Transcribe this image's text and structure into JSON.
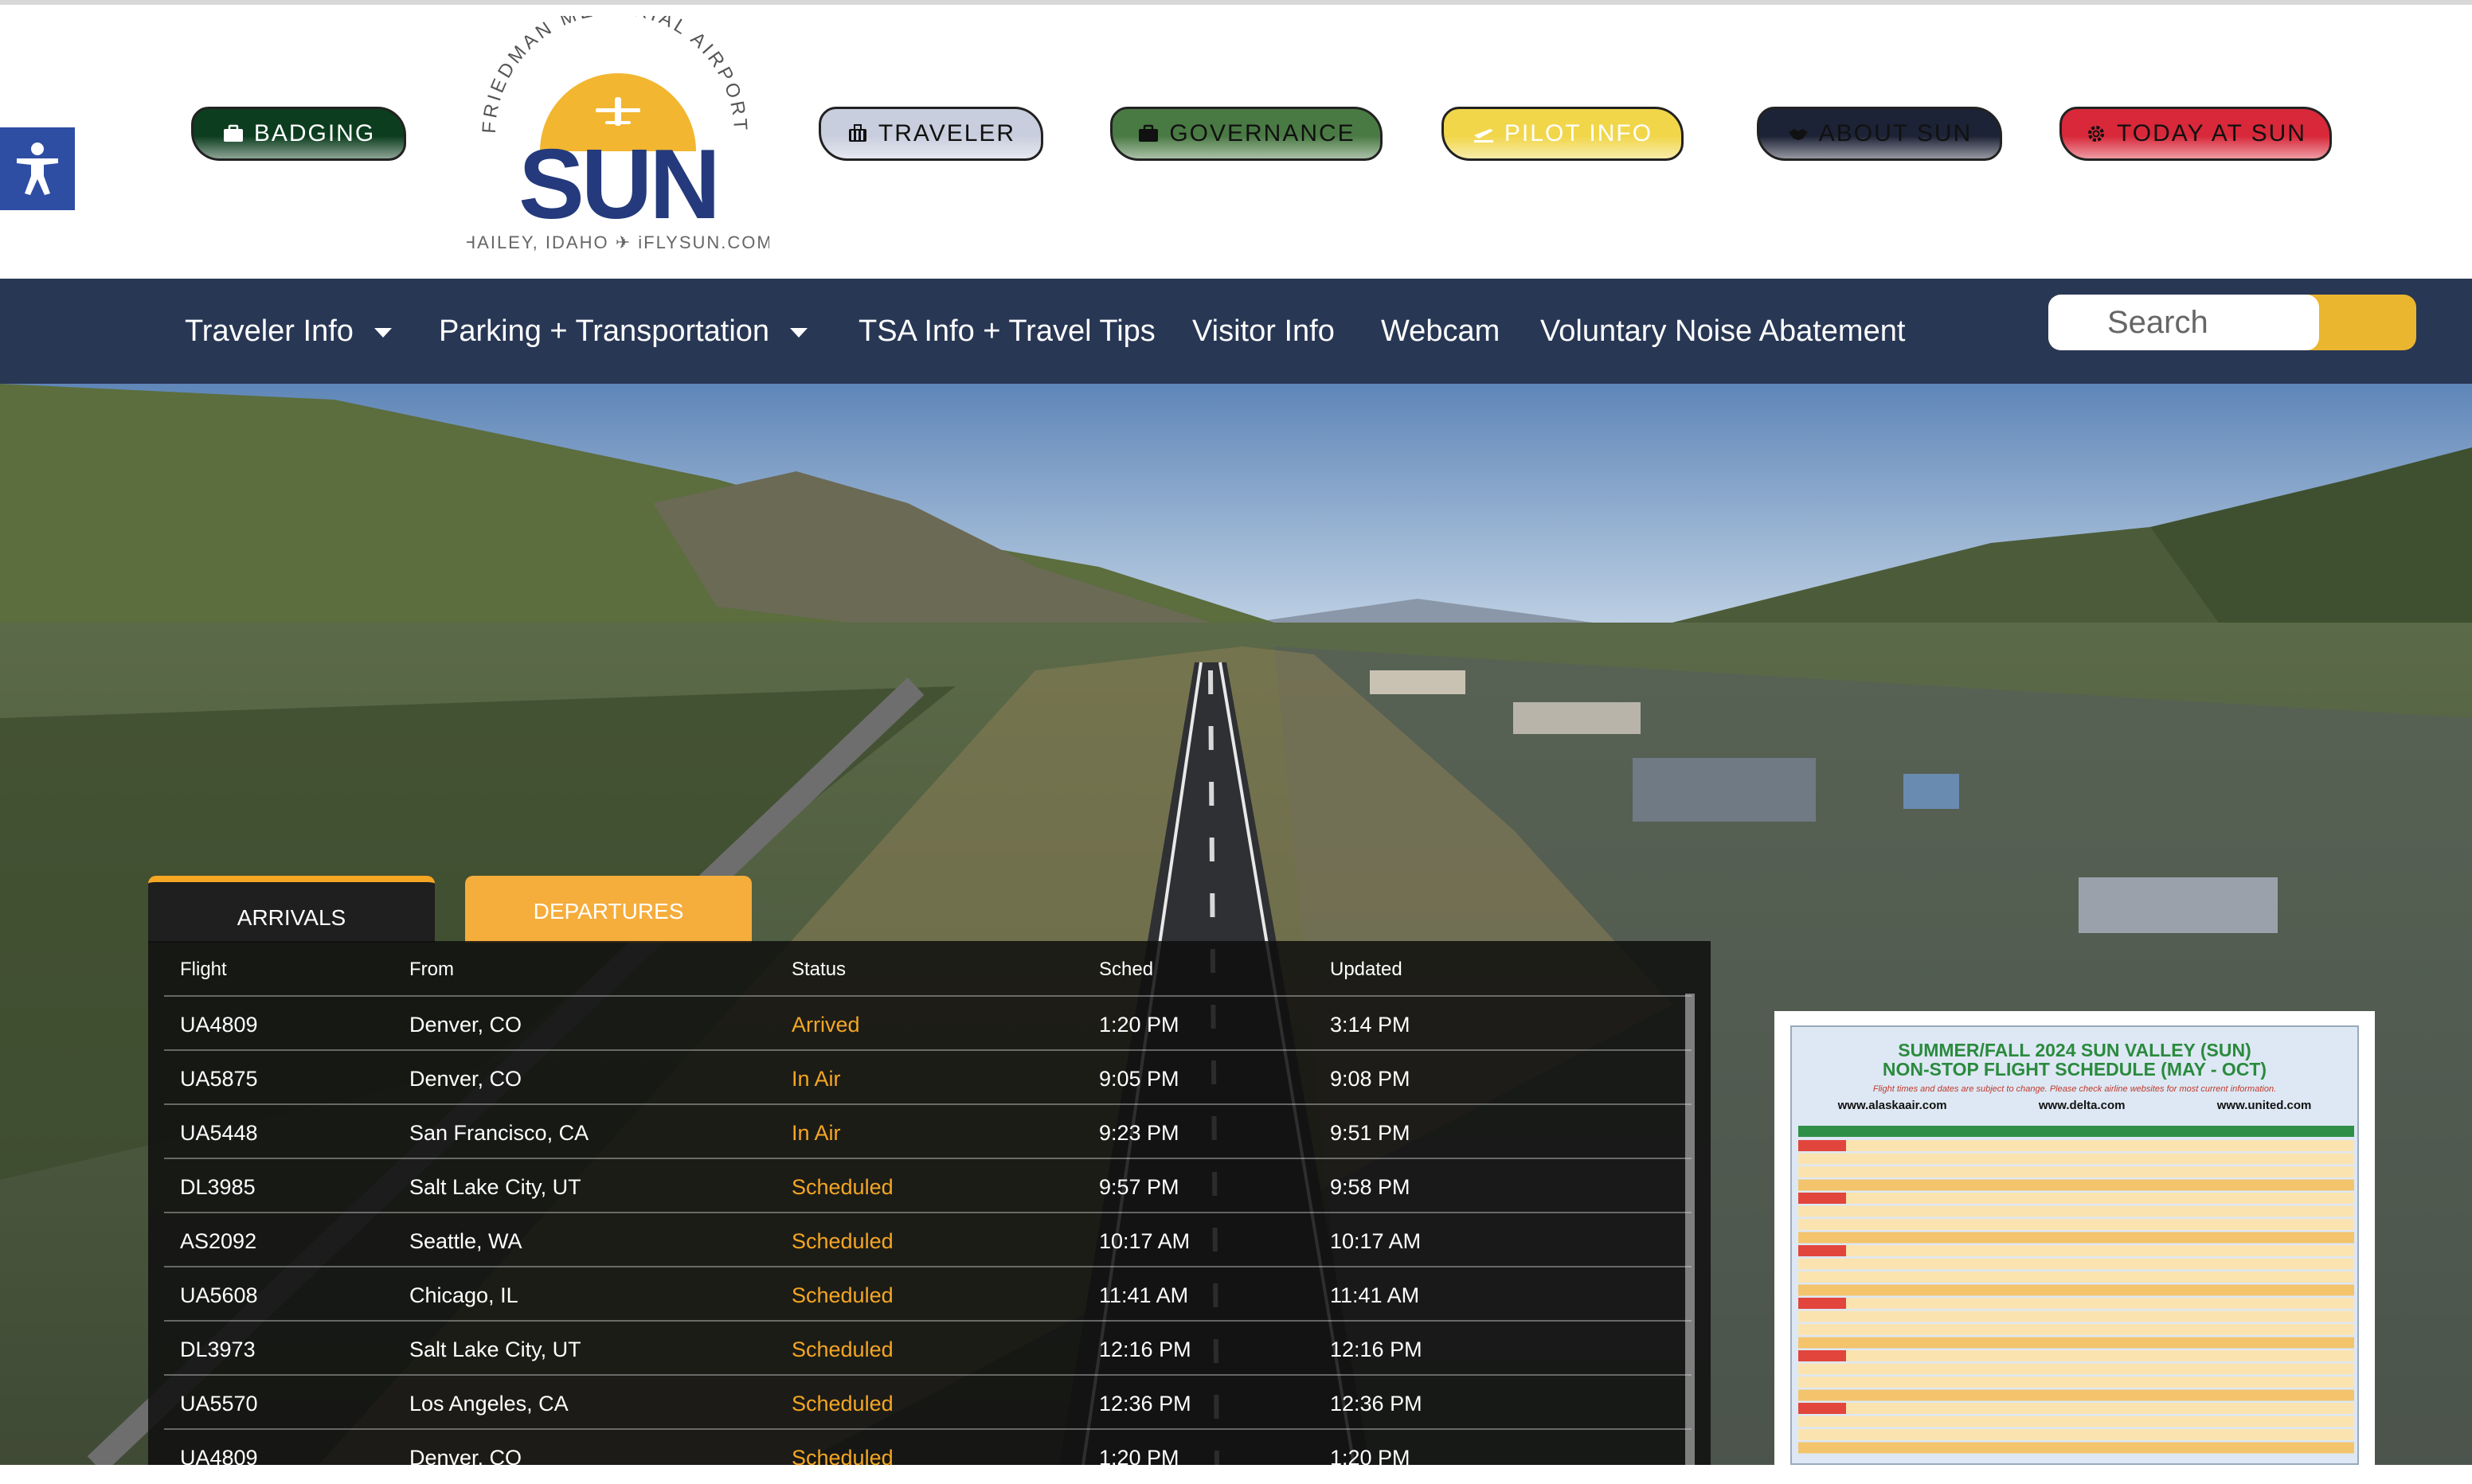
{
  "header": {
    "buttons": [
      {
        "label": "BADGING",
        "icon": "briefcase-icon",
        "bg": "#0c3d1e",
        "color": "#ffffff"
      },
      {
        "label": "TRAVELER",
        "icon": "luggage-icon",
        "bg": "#c9cede",
        "color": "#111111"
      },
      {
        "label": "GOVERNANCE",
        "icon": "briefcase-icon",
        "bg": "#4a7a44",
        "color": "#111111"
      },
      {
        "label": "PILOT INFO",
        "icon": "plane-departure-icon",
        "bg": "#f1d64a",
        "color": "#ffffff"
      },
      {
        "label": "ABOUT SUN",
        "icon": "handshake-icon",
        "bg": "#1d2336",
        "color": "#111111"
      },
      {
        "label": "TODAY AT SUN",
        "icon": "gear-icon",
        "bg": "#d8283a",
        "color": "#111111"
      }
    ],
    "logo": {
      "arc_text": "FRIEDMAN MEMORIAL AIRPORT",
      "wordmark": "SUN",
      "tagline": "HAILEY, IDAHO ✈ iFLYSUN.COM"
    }
  },
  "nav": {
    "items": [
      {
        "label": "Traveler Info",
        "has_dropdown": true
      },
      {
        "label": "Parking + Transportation",
        "has_dropdown": true
      },
      {
        "label": "TSA Info + Travel Tips",
        "has_dropdown": false
      },
      {
        "label": "Visitor Info",
        "has_dropdown": false
      },
      {
        "label": "Webcam",
        "has_dropdown": false
      },
      {
        "label": "Voluntary Noise Abatement",
        "has_dropdown": false
      }
    ],
    "search": {
      "placeholder": "Search",
      "value": ""
    }
  },
  "flights": {
    "tabs": {
      "arrivals": "ARRIVALS",
      "departures": "DEPARTURES",
      "active": "ARRIVALS"
    },
    "columns": [
      "Flight",
      "From",
      "Status",
      "Sched",
      "Updated"
    ],
    "rows": [
      {
        "flight": "UA4809",
        "from": "Denver, CO",
        "status": "Arrived",
        "sched": "1:20 PM",
        "updated": "3:14 PM"
      },
      {
        "flight": "UA5875",
        "from": "Denver, CO",
        "status": "In Air",
        "sched": "9:05 PM",
        "updated": "9:08 PM"
      },
      {
        "flight": "UA5448",
        "from": "San Francisco, CA",
        "status": "In Air",
        "sched": "9:23 PM",
        "updated": "9:51 PM"
      },
      {
        "flight": "DL3985",
        "from": "Salt Lake City, UT",
        "status": "Scheduled",
        "sched": "9:57 PM",
        "updated": "9:58 PM"
      },
      {
        "flight": "AS2092",
        "from": "Seattle, WA",
        "status": "Scheduled",
        "sched": "10:17 AM",
        "updated": "10:17 AM"
      },
      {
        "flight": "UA5608",
        "from": "Chicago, IL",
        "status": "Scheduled",
        "sched": "11:41 AM",
        "updated": "11:41 AM"
      },
      {
        "flight": "DL3973",
        "from": "Salt Lake City, UT",
        "status": "Scheduled",
        "sched": "12:16 PM",
        "updated": "12:16 PM"
      },
      {
        "flight": "UA5570",
        "from": "Los Angeles, CA",
        "status": "Scheduled",
        "sched": "12:36 PM",
        "updated": "12:36 PM"
      },
      {
        "flight": "UA4809",
        "from": "Denver, CO",
        "status": "Scheduled",
        "sched": "1:20 PM",
        "updated": "1:20 PM"
      }
    ]
  },
  "schedule_card": {
    "title_line1": "SUMMER/FALL 2024 SUN VALLEY (SUN)",
    "title_line2": "NON-STOP FLIGHT SCHEDULE (MAY - OCT)",
    "note": "Flight times and dates are subject to change. Please check airline websites for most current information.",
    "urls": [
      "www.alaskaair.com",
      "www.delta.com",
      "www.united.com"
    ]
  },
  "colors": {
    "nav_bg": "#283754",
    "accent_orange": "#f5a623",
    "search_gold": "#eab52f",
    "logo_navy": "#243a7d",
    "logo_sun": "#f2b631",
    "accessibility_blue": "#2d4ea3"
  }
}
